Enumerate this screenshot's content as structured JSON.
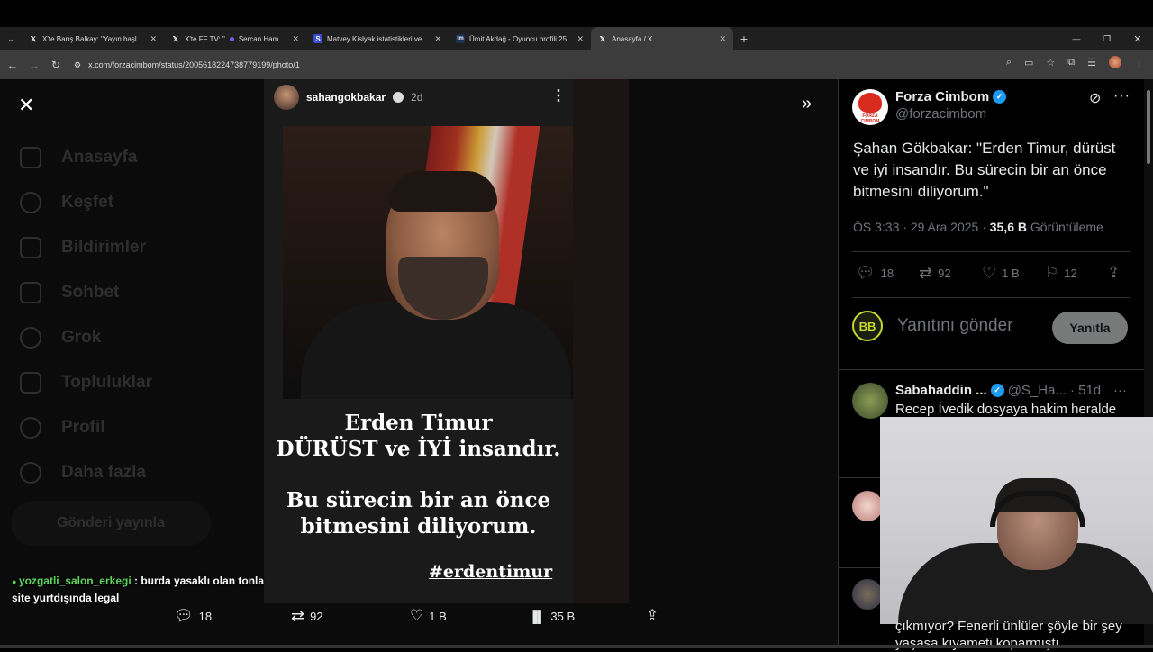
{
  "browser": {
    "tabs": [
      {
        "title": "X'te Barış Balkay: \"Yayın başladı",
        "icon": "x-logo",
        "active": false
      },
      {
        "title": "X'te FF TV: \"",
        "icon": "x-logo",
        "active": false
      },
      {
        "title": "Sercan Hamzao",
        "icon": "dot",
        "active": false
      },
      {
        "title": "Matvey Kislyak istatistikleri ve",
        "icon": "s-logo",
        "active": false
      },
      {
        "title": "Ümit Akdağ - Oyuncu profili 25",
        "icon": "tm-logo",
        "active": false
      },
      {
        "title": "Anasayfa / X",
        "icon": "x-logo",
        "active": true
      }
    ],
    "url": "x.com/forzacimbom/status/2005618224738779199/photo/1"
  },
  "nav_dim": [
    "Anasayfa",
    "Keşfet",
    "Bildirimler",
    "Sohbet",
    "Grok",
    "Topluluklar",
    "Profil",
    "Daha fazla"
  ],
  "post_button_dim": "Gönderi yayınla",
  "story": {
    "username": "sahangokbakar",
    "age": "2d",
    "line1": "Erden Timur",
    "line2": "DÜRÜST ve İYİ  insandır.",
    "line3": "Bu sürecin bir an önce",
    "line4": "bitmesini diliyorum.",
    "hashtag": "#erdentimur"
  },
  "chat": {
    "user": "yozgatli_salon_erkegi",
    "message": " : burda yasaklı olan tonla site yurtdışında legal"
  },
  "media_actions": {
    "replies": "18",
    "retweets": "92",
    "likes": "1 B",
    "views": "35 B"
  },
  "tweet": {
    "name": "Forza Cimbom",
    "handle": "@forzacimbom",
    "avatar_text": "FORZA CIMBOM",
    "text": "Şahan Gökbakar: \"Erden Timur, dürüst ve iyi insandır. Bu sürecin bir an önce bitmesini diliyorum.\"",
    "time": "ÖS 3:33 · 29 Ara 2025 · ",
    "views_count": "35,6 B",
    "views_label": " Görüntüleme",
    "stats": {
      "replies": "18",
      "retweets": "92",
      "likes": "1 B",
      "bookmarks": "12"
    }
  },
  "reply_box": {
    "placeholder": "Yanıtını gönder",
    "button": "Yanıtla",
    "avatar_text": "BB"
  },
  "replies": [
    {
      "name": "Sabahaddin ...",
      "handle": "@S_Ha...",
      "age": "· 51d",
      "text": "Recep İvedik dosyaya hakim heralde"
    }
  ],
  "last_reply_text": "çıkmıyor? Fenerli ünlüler şöyle bir şey yaşasa kıyameti koparmıştı",
  "colors": {
    "accent": "#1d9bf0",
    "chat_user": "#5fd35f",
    "reply_button": "#787a7a"
  }
}
